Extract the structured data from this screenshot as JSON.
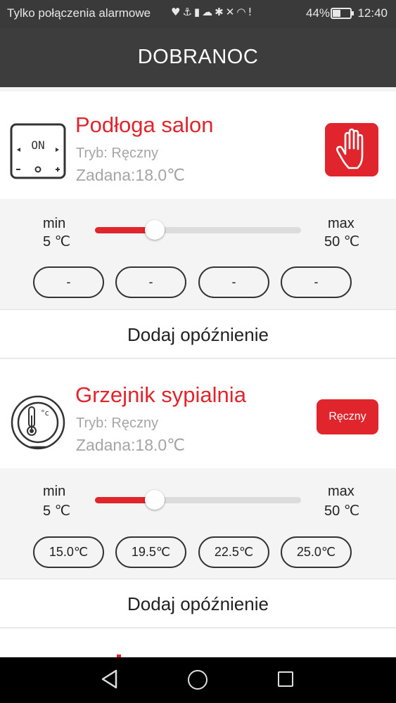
{
  "status_bar": {
    "carrier": "Tylko połączenia alarmowe",
    "icons": [
      "heart-monitor-icon",
      "usb-icon",
      "battery-saver-icon",
      "cloud-icon",
      "bluetooth-icon",
      "mute-icon",
      "wifi-icon",
      "alert-icon"
    ],
    "battery": "44%",
    "battery_level": 0.44,
    "time": "12:40"
  },
  "header": {
    "title": "DOBRANOC"
  },
  "devices": [
    {
      "name": "Podłoga salon",
      "icon": "floor-thermostat-icon",
      "display": "ON",
      "mode": "Tryb: Ręczny",
      "setpoint": "Zadana:18.0℃",
      "mode_button_icon": "hand-icon",
      "slider": {
        "min_label": "min",
        "min_value": "5 ℃",
        "max_label": "max",
        "max_value": "50 ℃",
        "value": 18.0,
        "min": 5,
        "max": 50
      },
      "presets": [
        "-",
        "-",
        "-",
        "-"
      ],
      "delay_label": "Dodaj opóźnienie"
    },
    {
      "name": "Grzejnik sypialnia",
      "icon": "radiator-thermostat-icon",
      "icon_text": "°c",
      "mode": "Tryb: Ręczny",
      "setpoint": "Zadana:18.0℃",
      "mode_button_label": "Ręczny",
      "slider": {
        "min_label": "min",
        "min_value": "5 ℃",
        "max_label": "max",
        "max_value": "50 ℃",
        "value": 18.0,
        "min": 5,
        "max": 50
      },
      "presets": [
        "15.0℃",
        "19.5℃",
        "22.5℃",
        "25.0℃"
      ],
      "delay_label": "Dodaj opóźnienie"
    }
  ],
  "colors": {
    "accent": "#e0252c",
    "header": "#3d3d3d",
    "muted": "#a5a5a5"
  },
  "nav_bar": {
    "buttons": [
      "back-icon",
      "home-icon",
      "recents-icon"
    ]
  }
}
